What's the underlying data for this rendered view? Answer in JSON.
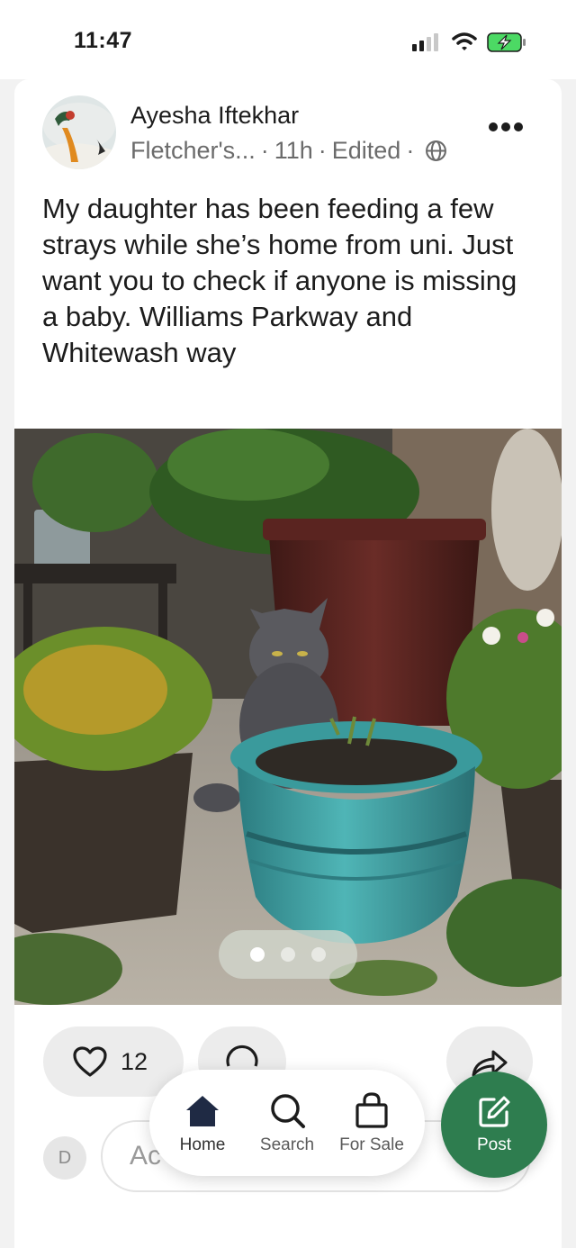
{
  "status_bar": {
    "time": "11:47"
  },
  "post": {
    "author_name": "Ayesha Iftekhar",
    "group": "Fletcher's...",
    "age": "11h",
    "edited": "Edited",
    "separator": "·",
    "text": "My daughter has been feeding a few strays while she’s home from uni. Just want you to check if anyone is missing a baby. Williams Parkway and Whitewash way",
    "image_count": 3,
    "active_image_index": 1
  },
  "actions": {
    "like_count": "12"
  },
  "comment": {
    "avatar_initial": "D",
    "placeholder": "Ac"
  },
  "nav": {
    "home_label": "Home",
    "search_label": "Search",
    "for_sale_label": "For Sale",
    "post_label": "Post"
  },
  "colors": {
    "accent_green": "#2e7d4f",
    "background": "#f2f2f2",
    "battery_charging": "#4cd964"
  }
}
